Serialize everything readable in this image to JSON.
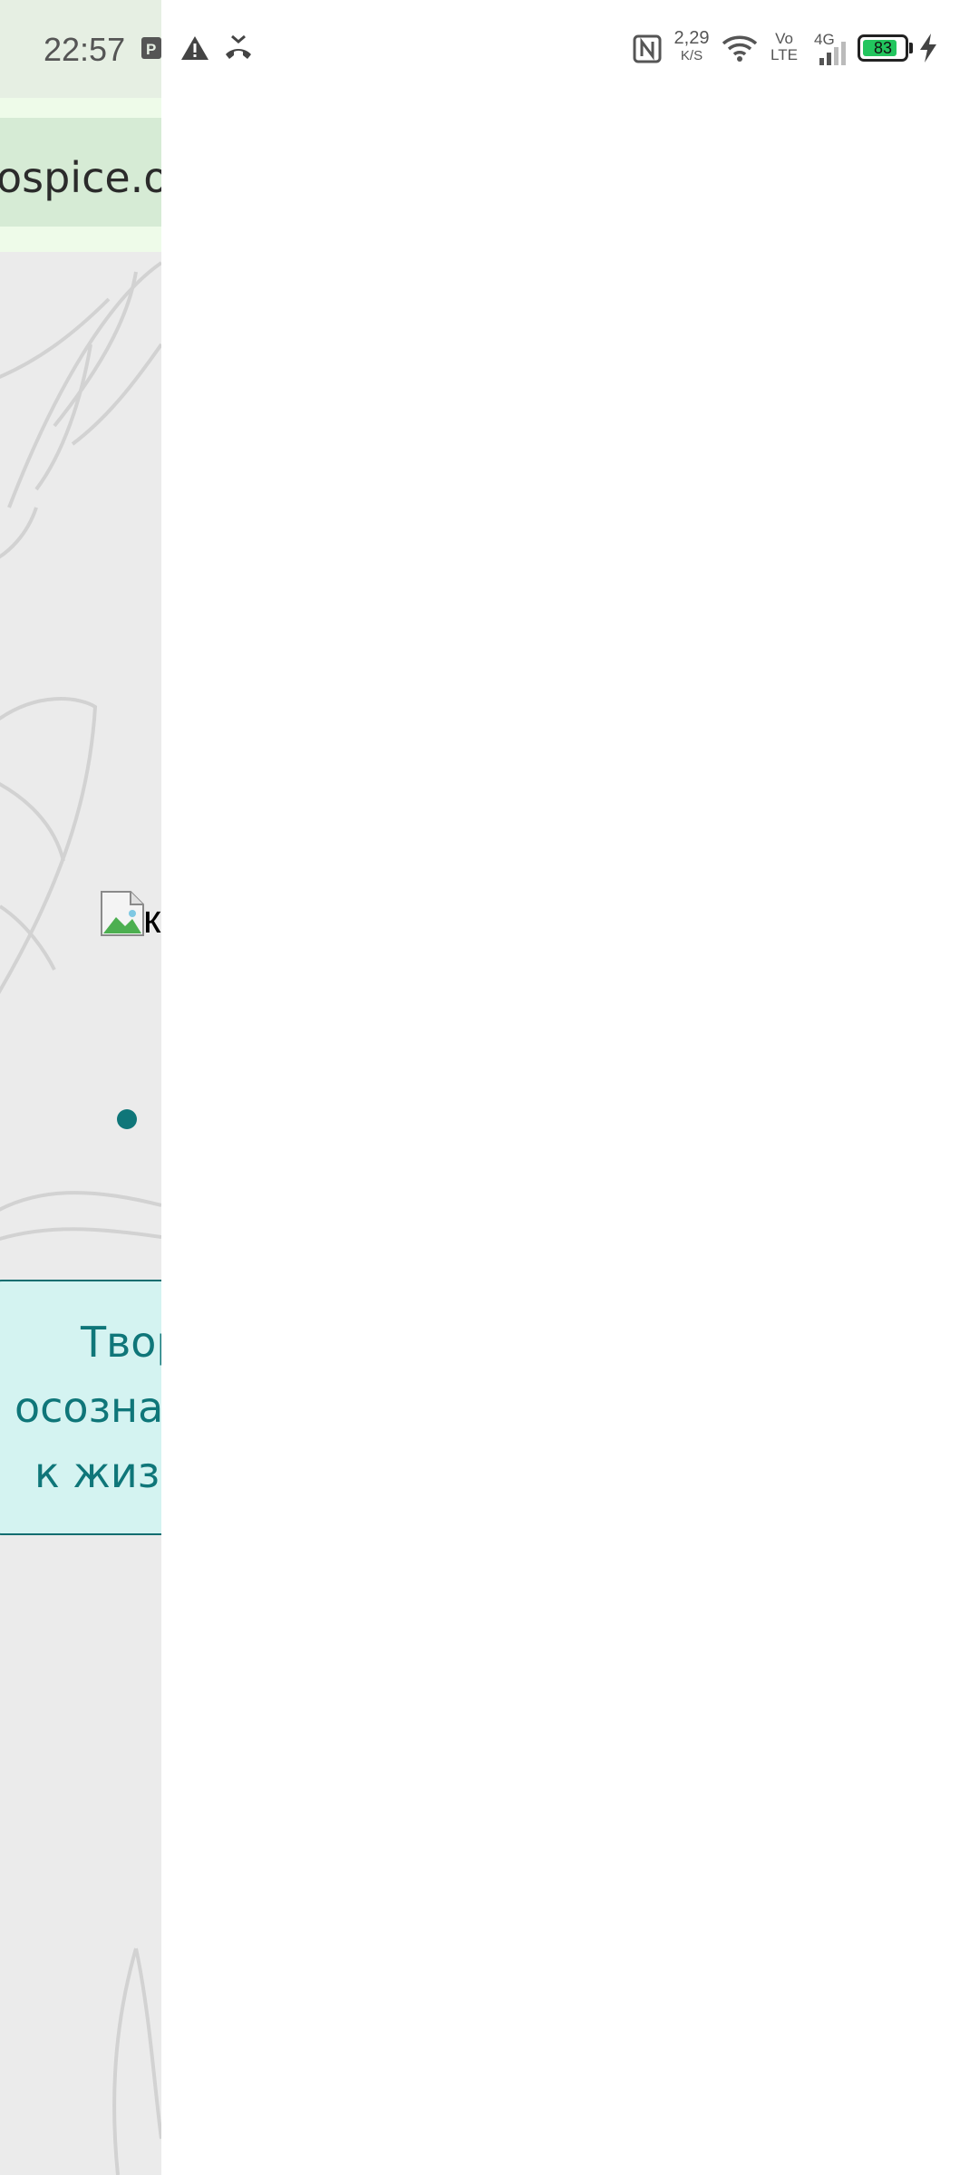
{
  "status_bar": {
    "time": "22:57",
    "net_speed_value": "2,29",
    "net_speed_unit": "K/S",
    "volte_top": "Vo",
    "volte_bottom": "LTE",
    "network_type": "4G",
    "battery_level": "83",
    "battery_percent": 83,
    "icons": [
      "parking-icon",
      "warning-icon",
      "missed-call-icon",
      "nfc-icon",
      "wifi-icon",
      "signal-icon",
      "charging-icon"
    ]
  },
  "browser": {
    "url_fragment": "ospice.or"
  },
  "page": {
    "broken_image_alt": "к",
    "quote_lines": [
      "Твор",
      "осознан",
      "к жизн"
    ]
  },
  "colors": {
    "accent_teal": "#0f7679",
    "card_bg": "#d4f3f1",
    "urlbar_bg": "#d6ebd5",
    "page_bg": "#ebebeb",
    "battery_green": "#22c55e"
  }
}
